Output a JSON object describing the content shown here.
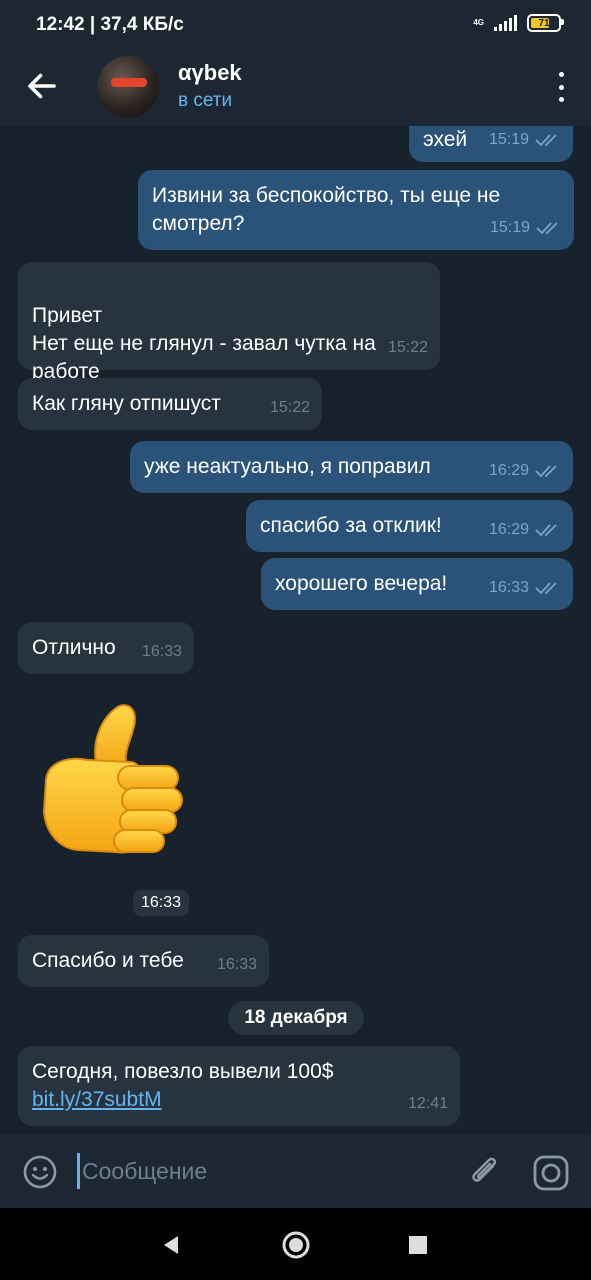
{
  "status_bar": {
    "time_speed": "12:42 | 37,4 КБ/с",
    "network": "4G",
    "battery": "71"
  },
  "header": {
    "name": "αγbek",
    "status": "в сети"
  },
  "messages": [
    {
      "dir": "out",
      "text": "эхей",
      "time": "15:19",
      "read": true
    },
    {
      "dir": "out",
      "text": "Извини за беспокойство, ты еще не смотрел?",
      "time": "15:19",
      "read": true
    },
    {
      "dir": "in",
      "text": "Привет\nНет еще не глянул - завал чутка на работе",
      "time": "15:22"
    },
    {
      "dir": "in",
      "text": "Как гляну отпишуст",
      "time": "15:22"
    },
    {
      "dir": "out",
      "text": "уже неактуально, я поправил",
      "time": "16:29",
      "read": true
    },
    {
      "dir": "out",
      "text": "спасибо за отклик!",
      "time": "16:29",
      "read": true
    },
    {
      "dir": "out",
      "text": "хорошего вечера!",
      "time": "16:33",
      "read": true
    },
    {
      "dir": "in",
      "text": "Отлично",
      "time": "16:33"
    },
    {
      "dir": "in",
      "sticker": "thumbs-up",
      "time": "16:33"
    },
    {
      "dir": "in",
      "text": "Спасибо и тебе",
      "time": "16:33"
    },
    {
      "dir": "in",
      "text": "Сегодня, повезло вывели 100$",
      "link": "bit.ly/37subtM",
      "time": "12:41"
    }
  ],
  "date_separator": "18 декабря",
  "composer": {
    "placeholder": "Сообщение"
  },
  "colors": {
    "background": "#18222d",
    "header": "#1c2733",
    "outgoing_bubble": "#2b5278",
    "incoming_bubble": "#27333f",
    "accent": "#64b5ef"
  }
}
